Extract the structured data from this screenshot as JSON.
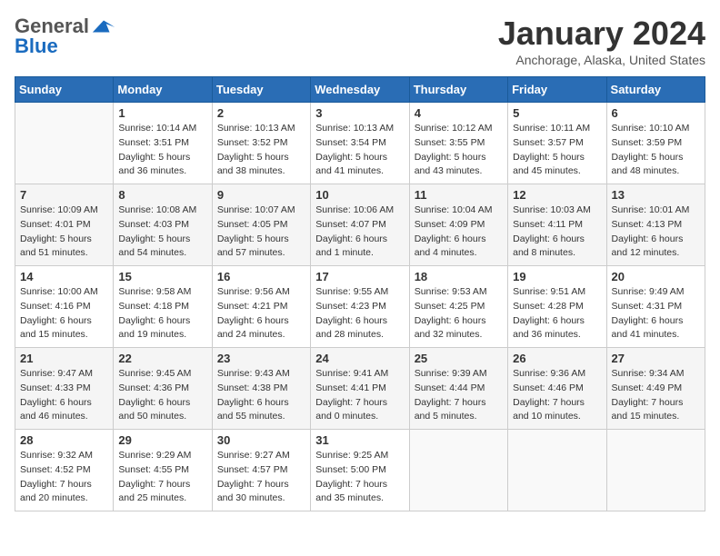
{
  "header": {
    "logo_general": "General",
    "logo_blue": "Blue",
    "month_title": "January 2024",
    "location": "Anchorage, Alaska, United States"
  },
  "weekdays": [
    "Sunday",
    "Monday",
    "Tuesday",
    "Wednesday",
    "Thursday",
    "Friday",
    "Saturday"
  ],
  "weeks": [
    [
      {
        "day": "",
        "info": ""
      },
      {
        "day": "1",
        "info": "Sunrise: 10:14 AM\nSunset: 3:51 PM\nDaylight: 5 hours\nand 36 minutes."
      },
      {
        "day": "2",
        "info": "Sunrise: 10:13 AM\nSunset: 3:52 PM\nDaylight: 5 hours\nand 38 minutes."
      },
      {
        "day": "3",
        "info": "Sunrise: 10:13 AM\nSunset: 3:54 PM\nDaylight: 5 hours\nand 41 minutes."
      },
      {
        "day": "4",
        "info": "Sunrise: 10:12 AM\nSunset: 3:55 PM\nDaylight: 5 hours\nand 43 minutes."
      },
      {
        "day": "5",
        "info": "Sunrise: 10:11 AM\nSunset: 3:57 PM\nDaylight: 5 hours\nand 45 minutes."
      },
      {
        "day": "6",
        "info": "Sunrise: 10:10 AM\nSunset: 3:59 PM\nDaylight: 5 hours\nand 48 minutes."
      }
    ],
    [
      {
        "day": "7",
        "info": "Sunrise: 10:09 AM\nSunset: 4:01 PM\nDaylight: 5 hours\nand 51 minutes."
      },
      {
        "day": "8",
        "info": "Sunrise: 10:08 AM\nSunset: 4:03 PM\nDaylight: 5 hours\nand 54 minutes."
      },
      {
        "day": "9",
        "info": "Sunrise: 10:07 AM\nSunset: 4:05 PM\nDaylight: 5 hours\nand 57 minutes."
      },
      {
        "day": "10",
        "info": "Sunrise: 10:06 AM\nSunset: 4:07 PM\nDaylight: 6 hours\nand 1 minute."
      },
      {
        "day": "11",
        "info": "Sunrise: 10:04 AM\nSunset: 4:09 PM\nDaylight: 6 hours\nand 4 minutes."
      },
      {
        "day": "12",
        "info": "Sunrise: 10:03 AM\nSunset: 4:11 PM\nDaylight: 6 hours\nand 8 minutes."
      },
      {
        "day": "13",
        "info": "Sunrise: 10:01 AM\nSunset: 4:13 PM\nDaylight: 6 hours\nand 12 minutes."
      }
    ],
    [
      {
        "day": "14",
        "info": "Sunrise: 10:00 AM\nSunset: 4:16 PM\nDaylight: 6 hours\nand 15 minutes."
      },
      {
        "day": "15",
        "info": "Sunrise: 9:58 AM\nSunset: 4:18 PM\nDaylight: 6 hours\nand 19 minutes."
      },
      {
        "day": "16",
        "info": "Sunrise: 9:56 AM\nSunset: 4:21 PM\nDaylight: 6 hours\nand 24 minutes."
      },
      {
        "day": "17",
        "info": "Sunrise: 9:55 AM\nSunset: 4:23 PM\nDaylight: 6 hours\nand 28 minutes."
      },
      {
        "day": "18",
        "info": "Sunrise: 9:53 AM\nSunset: 4:25 PM\nDaylight: 6 hours\nand 32 minutes."
      },
      {
        "day": "19",
        "info": "Sunrise: 9:51 AM\nSunset: 4:28 PM\nDaylight: 6 hours\nand 36 minutes."
      },
      {
        "day": "20",
        "info": "Sunrise: 9:49 AM\nSunset: 4:31 PM\nDaylight: 6 hours\nand 41 minutes."
      }
    ],
    [
      {
        "day": "21",
        "info": "Sunrise: 9:47 AM\nSunset: 4:33 PM\nDaylight: 6 hours\nand 46 minutes."
      },
      {
        "day": "22",
        "info": "Sunrise: 9:45 AM\nSunset: 4:36 PM\nDaylight: 6 hours\nand 50 minutes."
      },
      {
        "day": "23",
        "info": "Sunrise: 9:43 AM\nSunset: 4:38 PM\nDaylight: 6 hours\nand 55 minutes."
      },
      {
        "day": "24",
        "info": "Sunrise: 9:41 AM\nSunset: 4:41 PM\nDaylight: 7 hours\nand 0 minutes."
      },
      {
        "day": "25",
        "info": "Sunrise: 9:39 AM\nSunset: 4:44 PM\nDaylight: 7 hours\nand 5 minutes."
      },
      {
        "day": "26",
        "info": "Sunrise: 9:36 AM\nSunset: 4:46 PM\nDaylight: 7 hours\nand 10 minutes."
      },
      {
        "day": "27",
        "info": "Sunrise: 9:34 AM\nSunset: 4:49 PM\nDaylight: 7 hours\nand 15 minutes."
      }
    ],
    [
      {
        "day": "28",
        "info": "Sunrise: 9:32 AM\nSunset: 4:52 PM\nDaylight: 7 hours\nand 20 minutes."
      },
      {
        "day": "29",
        "info": "Sunrise: 9:29 AM\nSunset: 4:55 PM\nDaylight: 7 hours\nand 25 minutes."
      },
      {
        "day": "30",
        "info": "Sunrise: 9:27 AM\nSunset: 4:57 PM\nDaylight: 7 hours\nand 30 minutes."
      },
      {
        "day": "31",
        "info": "Sunrise: 9:25 AM\nSunset: 5:00 PM\nDaylight: 7 hours\nand 35 minutes."
      },
      {
        "day": "",
        "info": ""
      },
      {
        "day": "",
        "info": ""
      },
      {
        "day": "",
        "info": ""
      }
    ]
  ]
}
